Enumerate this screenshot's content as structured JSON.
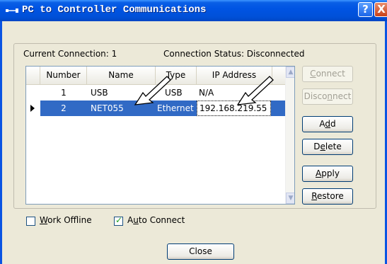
{
  "window": {
    "title": "PC to Controller Communications",
    "help": "?",
    "close": "X"
  },
  "status": {
    "current_connection": "Current Connection: 1",
    "connection_status": "Connection Status: Disconnected"
  },
  "table": {
    "headers": [
      "Number",
      "Name",
      "Type",
      "IP Address"
    ],
    "rows": [
      {
        "number": "1",
        "name": "USB",
        "type": "USB",
        "ip": "N/A",
        "selected": false
      },
      {
        "number": "2",
        "name": "NET055",
        "type": "Ethernet",
        "ip": "192.168.219.55",
        "selected": true
      }
    ]
  },
  "buttons": {
    "connect": {
      "pre": "",
      "key": "C",
      "post": "onnect"
    },
    "disconnect": {
      "pre": "Disco",
      "key": "n",
      "post": "nect"
    },
    "add": {
      "pre": "A",
      "key": "d",
      "post": "d"
    },
    "delete": {
      "pre": "D",
      "key": "e",
      "post": "lete"
    },
    "apply": {
      "pre": "",
      "key": "A",
      "post": "pply"
    },
    "restore": {
      "pre": "",
      "key": "R",
      "post": "estore"
    },
    "close": "Close"
  },
  "options": {
    "work_offline": {
      "key": "W",
      "rest": "ork Offline",
      "checked": false
    },
    "auto_connect": {
      "pre": "A",
      "key": "u",
      "rest": "to Connect",
      "checked": true
    }
  },
  "colors": {
    "titlebar": "#0054e3",
    "selection": "#316ac5",
    "dialog_bg": "#ece9d8"
  }
}
